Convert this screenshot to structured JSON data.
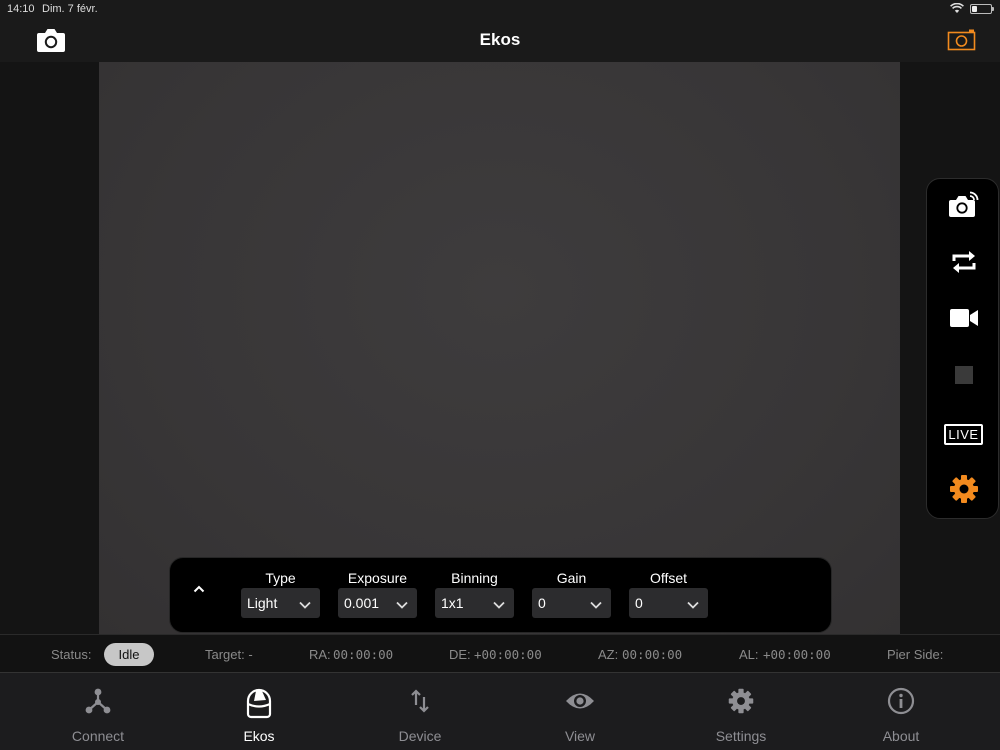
{
  "status_bar": {
    "time": "14:10",
    "date": "Dim. 7 févr."
  },
  "nav": {
    "title": "Ekos",
    "left_icon": "camera-icon",
    "right_icon": "camera-frame-icon",
    "accent": "#f28a1e"
  },
  "side_toolbar": {
    "tools": [
      {
        "name": "capture-preview",
        "icon": "camera-wireless-icon"
      },
      {
        "name": "loop",
        "icon": "loop-arrows-icon"
      },
      {
        "name": "video",
        "icon": "video-camera-icon"
      },
      {
        "name": "stop",
        "icon": "stop-square-icon"
      },
      {
        "name": "live",
        "icon": "live-badge-icon",
        "label": "LIVE"
      },
      {
        "name": "settings",
        "icon": "gear-icon"
      }
    ]
  },
  "capture": {
    "type_label": "Type",
    "type_value": "Light",
    "exposure_label": "Exposure",
    "exposure_value": "0.001",
    "binning_label": "Binning",
    "binning_value": "1x1",
    "gain_label": "Gain",
    "gain_value": "0",
    "offset_label": "Offset",
    "offset_value": "0"
  },
  "info": {
    "status_label": "Status:",
    "status_value": "Idle",
    "target": "Target: -",
    "ra_label": "RA:",
    "ra_value": "00:00:00",
    "de_label": "DE:",
    "de_value": "+00:00:00",
    "az_label": "AZ:",
    "az_value": "00:00:00",
    "al_label": "AL:",
    "al_value": "+00:00:00",
    "pier_label": "Pier Side:"
  },
  "tabs": [
    {
      "label": "Connect",
      "icon": "network-nodes-icon",
      "active": false
    },
    {
      "label": "Ekos",
      "icon": "telescope-dome-icon",
      "active": true
    },
    {
      "label": "Device",
      "icon": "up-down-arrows-icon",
      "active": false
    },
    {
      "label": "View",
      "icon": "eye-icon",
      "active": false
    },
    {
      "label": "Settings",
      "icon": "gear-icon",
      "active": false
    },
    {
      "label": "About",
      "icon": "info-icon",
      "active": false
    }
  ]
}
